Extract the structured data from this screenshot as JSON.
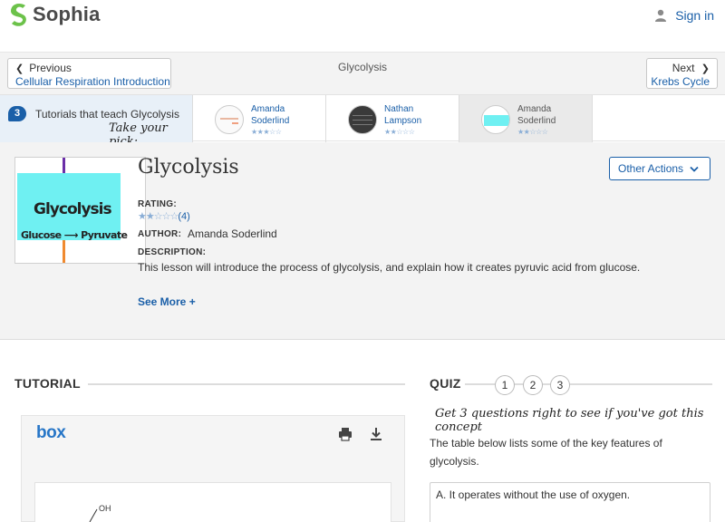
{
  "header": {
    "brand": "Sophia",
    "signin_label": "Sign in"
  },
  "nav": {
    "prev_label": "Previous",
    "prev_link": "Cellular Respiration Introduction",
    "crumb": "Glycolysis",
    "next_label": "Next",
    "next_link": "Krebs Cycle"
  },
  "strip": {
    "count": "3",
    "title": "Tutorials that teach Glycolysis",
    "pick": "Take your pick:",
    "cards": [
      {
        "name_line1": "Amanda",
        "name_line2": "Soderlind",
        "stars": "★★★☆☆",
        "rating": 3
      },
      {
        "name_line1": "Nathan",
        "name_line2": "Lampson",
        "stars": "★★☆☆☆",
        "rating": 2
      },
      {
        "name_line1": "Amanda",
        "name_line2": "Soderlind",
        "stars": "★★☆☆☆",
        "rating": 2
      }
    ]
  },
  "lesson": {
    "thumb_line1": "Glycolysis",
    "thumb_line2": "Glucose ⟶ Pyruvate",
    "title": "Glycolysis",
    "rating_label": "RATING:",
    "rating_stars": "★★☆☆☆",
    "rating_value": 2,
    "rating_count": "(4)",
    "author_label": "AUTHOR:",
    "author": "Amanda Soderlind",
    "description_label": "DESCRIPTION:",
    "description": "This lesson will introduce the process of glycolysis, and explain how it creates pyruvic acid from glucose.",
    "see_more": "See More +",
    "other_actions": "Other Actions"
  },
  "tutorial": {
    "title": "TUTORIAL",
    "viewer_brand": "box"
  },
  "quiz": {
    "title": "QUIZ",
    "steps": [
      "1",
      "2",
      "3"
    ],
    "hint": "Get 3 questions right to see if you've got this concept",
    "question": "The table below lists some of the key features of glycolysis.",
    "answer_a": "A. It operates without the use of oxygen."
  },
  "colors": {
    "accent": "#1a5fa8",
    "brand_green": "#6cc24a",
    "panel": "#f3f3f3"
  }
}
